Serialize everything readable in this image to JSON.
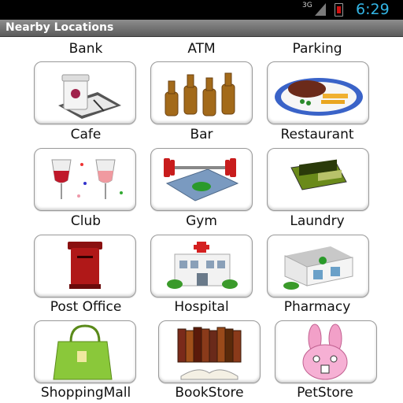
{
  "status_bar": {
    "network": "3G",
    "time": "6:29",
    "colors": {
      "time": "#33b5e5",
      "battery": "#d01010"
    }
  },
  "title": "Nearby Locations",
  "top_row": [
    {
      "label": "Bank"
    },
    {
      "label": "ATM"
    },
    {
      "label": "Parking"
    }
  ],
  "items": [
    {
      "label": "Cafe",
      "icon": "coffee-cup-icon"
    },
    {
      "label": "Bar",
      "icon": "beer-bottles-icon"
    },
    {
      "label": "Restaurant",
      "icon": "steak-plate-icon"
    },
    {
      "label": "Club",
      "icon": "wine-glasses-icon"
    },
    {
      "label": "Gym",
      "icon": "barbell-icon"
    },
    {
      "label": "Laundry",
      "icon": "washboard-icon"
    },
    {
      "label": "Post Office",
      "icon": "postbox-icon"
    },
    {
      "label": "Hospital",
      "icon": "hospital-building-icon"
    },
    {
      "label": "Pharmacy",
      "icon": "pharmacy-building-icon"
    },
    {
      "label": "ShoppingMall",
      "icon": "shopping-bag-icon"
    },
    {
      "label": "BookStore",
      "icon": "books-icon"
    },
    {
      "label": "PetStore",
      "icon": "bunny-icon"
    }
  ]
}
